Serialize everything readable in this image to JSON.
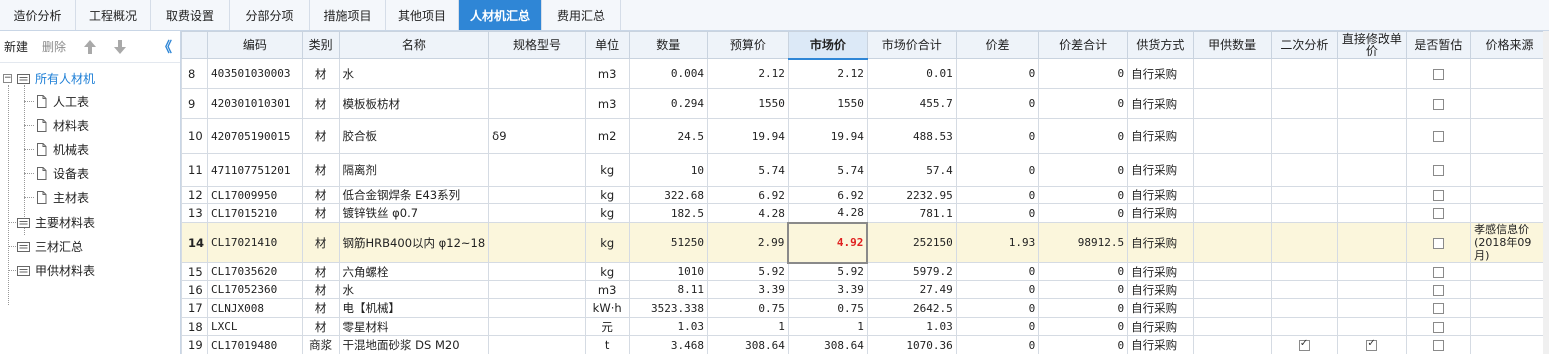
{
  "tabs": [
    "造价分析",
    "工程概况",
    "取费设置",
    "分部分项",
    "措施项目",
    "其他项目",
    "人材机汇总",
    "费用汇总"
  ],
  "active_tab": "人材机汇总",
  "left_toolbar": {
    "new": "新建",
    "delete": "删除",
    "collapse": "《"
  },
  "tree": {
    "root": "所有人材机",
    "children": [
      "人工表",
      "材料表",
      "机械表",
      "设备表",
      "主材表"
    ],
    "others": [
      "主要材料表",
      "三材汇总",
      "甲供材料表"
    ]
  },
  "columns": [
    "编码",
    "类别",
    "名称",
    "规格型号",
    "单位",
    "数量",
    "预算价",
    "市场价",
    "市场价合计",
    "价差",
    "价差合计",
    "供货方式",
    "甲供数量",
    "二次分析",
    "直接修改单价",
    "是否暂估",
    "价格来源"
  ],
  "rows": [
    {
      "idx": "8",
      "code": "403501030003",
      "cat": "材",
      "name": "水",
      "spec": "",
      "unit": "m3",
      "qty": "0.004",
      "budget": "2.12",
      "market": "2.12",
      "total": "0.01",
      "diff": "0",
      "diff_total": "0",
      "supply": "自行采购",
      "jq": "",
      "sec": false,
      "direct": false,
      "est": false,
      "source": ""
    },
    {
      "idx": "9",
      "code": "420301010301",
      "cat": "材",
      "name": "模板板枋材",
      "spec": "",
      "unit": "m3",
      "qty": "0.294",
      "budget": "1550",
      "market": "1550",
      "total": "455.7",
      "diff": "0",
      "diff_total": "0",
      "supply": "自行采购",
      "jq": "",
      "sec": false,
      "direct": false,
      "est": false,
      "source": ""
    },
    {
      "idx": "10",
      "code": "420705190015",
      "cat": "材",
      "name": "胶合板",
      "spec": "δ9",
      "unit": "m2",
      "qty": "24.5",
      "budget": "19.94",
      "market": "19.94",
      "total": "488.53",
      "diff": "0",
      "diff_total": "0",
      "supply": "自行采购",
      "jq": "",
      "sec": false,
      "direct": false,
      "est": false,
      "source": ""
    },
    {
      "idx": "11",
      "code": "471107751201",
      "cat": "材",
      "name": "隔离剂",
      "spec": "",
      "unit": "kg",
      "qty": "10",
      "budget": "5.74",
      "market": "5.74",
      "total": "57.4",
      "diff": "0",
      "diff_total": "0",
      "supply": "自行采购",
      "jq": "",
      "sec": false,
      "direct": false,
      "est": false,
      "source": ""
    },
    {
      "idx": "12",
      "code": "CL17009950",
      "cat": "材",
      "name": "低合金钢焊条 E43系列",
      "spec": "",
      "unit": "kg",
      "qty": "322.68",
      "budget": "6.92",
      "market": "6.92",
      "total": "2232.95",
      "diff": "0",
      "diff_total": "0",
      "supply": "自行采购",
      "jq": "",
      "sec": false,
      "direct": false,
      "est": false,
      "source": ""
    },
    {
      "idx": "13",
      "code": "CL17015210",
      "cat": "材",
      "name": "镀锌铁丝 φ0.7",
      "spec": "",
      "unit": "kg",
      "qty": "182.5",
      "budget": "4.28",
      "market": "4.28",
      "total": "781.1",
      "diff": "0",
      "diff_total": "0",
      "supply": "自行采购",
      "jq": "",
      "sec": false,
      "direct": false,
      "est": false,
      "source": ""
    },
    {
      "idx": "14",
      "code": "CL17021410",
      "cat": "材",
      "name": "钢筋HRB400以内 φ12~18",
      "spec": "",
      "unit": "kg",
      "qty": "51250",
      "budget": "2.99",
      "market": "4.92",
      "total": "252150",
      "diff": "1.93",
      "diff_total": "98912.5",
      "supply": "自行采购",
      "jq": "",
      "sec": false,
      "direct": false,
      "est": false,
      "source": "孝感信息价(2018年09月)"
    },
    {
      "idx": "15",
      "code": "CL17035620",
      "cat": "材",
      "name": "六角螺栓",
      "spec": "",
      "unit": "kg",
      "qty": "1010",
      "budget": "5.92",
      "market": "5.92",
      "total": "5979.2",
      "diff": "0",
      "diff_total": "0",
      "supply": "自行采购",
      "jq": "",
      "sec": false,
      "direct": false,
      "est": false,
      "source": ""
    },
    {
      "idx": "16",
      "code": "CL17052360",
      "cat": "材",
      "name": "水",
      "spec": "",
      "unit": "m3",
      "qty": "8.11",
      "budget": "3.39",
      "market": "3.39",
      "total": "27.49",
      "diff": "0",
      "diff_total": "0",
      "supply": "自行采购",
      "jq": "",
      "sec": false,
      "direct": false,
      "est": false,
      "source": ""
    },
    {
      "idx": "17",
      "code": "CLNJX008",
      "cat": "材",
      "name": "电【机械】",
      "spec": "",
      "unit": "kW·h",
      "qty": "3523.338",
      "budget": "0.75",
      "market": "0.75",
      "total": "2642.5",
      "diff": "0",
      "diff_total": "0",
      "supply": "自行采购",
      "jq": "",
      "sec": false,
      "direct": false,
      "est": false,
      "source": ""
    },
    {
      "idx": "18",
      "code": "LXCL",
      "cat": "材",
      "name": "零星材料",
      "spec": "",
      "unit": "元",
      "qty": "1.03",
      "budget": "1",
      "market": "1",
      "total": "1.03",
      "diff": "0",
      "diff_total": "0",
      "supply": "自行采购",
      "jq": "",
      "sec": false,
      "direct": false,
      "est": false,
      "source": ""
    },
    {
      "idx": "19",
      "code": "CL17019480",
      "cat": "商浆",
      "name": "干混地面砂浆 DS M20",
      "spec": "",
      "unit": "t",
      "qty": "3.468",
      "budget": "308.64",
      "market": "308.64",
      "total": "1070.36",
      "diff": "0",
      "diff_total": "0",
      "supply": "自行采购",
      "jq": "",
      "sec": true,
      "direct": true,
      "est": false,
      "source": ""
    }
  ]
}
